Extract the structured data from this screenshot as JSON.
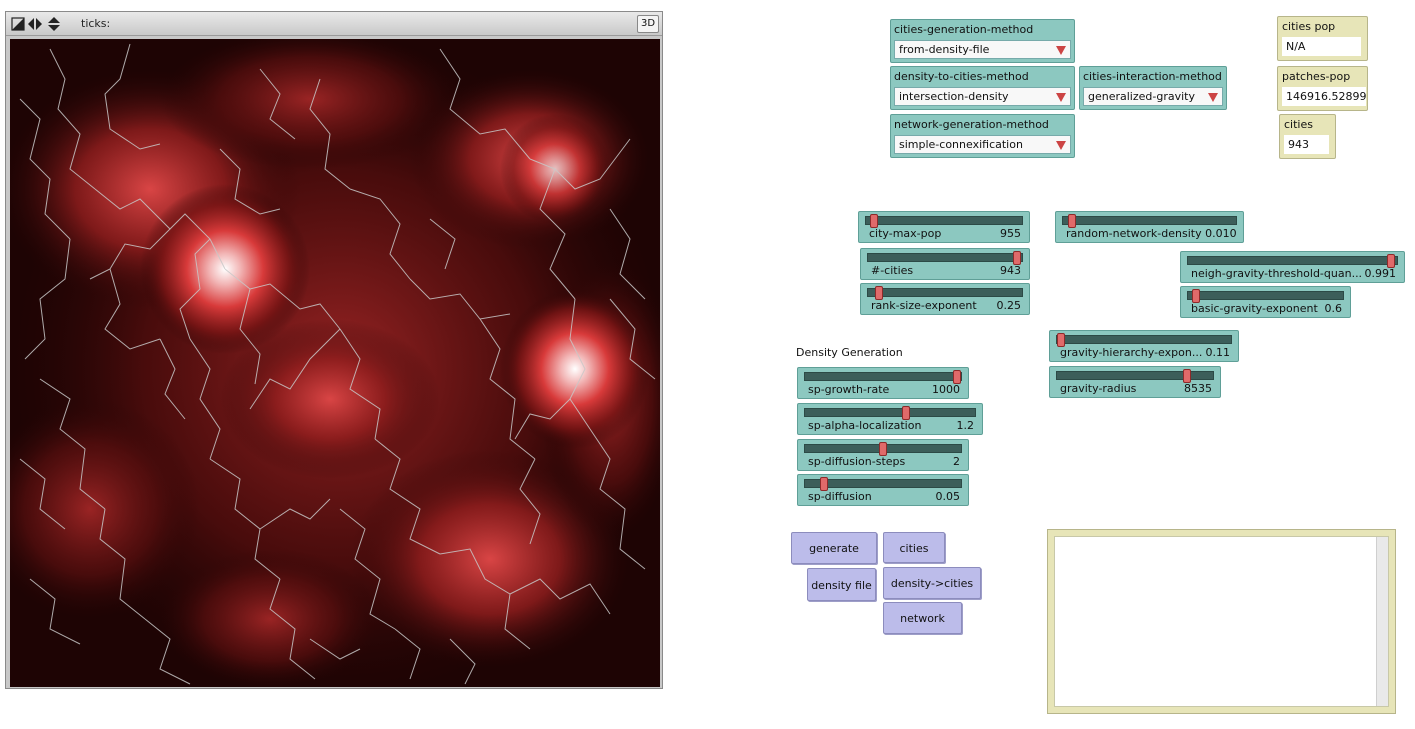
{
  "view": {
    "ticks_label": "ticks:",
    "btn_3d": "3D"
  },
  "choosers": {
    "cities_generation_method": {
      "label": "cities-generation-method",
      "value": "from-density-file"
    },
    "density_to_cities_method": {
      "label": "density-to-cities-method",
      "value": "intersection-density"
    },
    "cities_interaction_method": {
      "label": "cities-interaction-method",
      "value": "generalized-gravity"
    },
    "network_generation_method": {
      "label": "network-generation-method",
      "value": "simple-connexification"
    }
  },
  "monitors": {
    "cities_pop": {
      "label": "cities pop",
      "value": "N/A"
    },
    "patches_pop": {
      "label": "patches-pop",
      "value": "146916.52899"
    },
    "cities": {
      "label": "cities",
      "value": "943"
    }
  },
  "sliders": {
    "city_max_pop": {
      "name": "city-max-pop",
      "value": "955",
      "fraction": 0.03
    },
    "n_cities": {
      "name": "#-cities",
      "value": "943",
      "fraction": 0.99
    },
    "rank_size_exponent": {
      "name": "rank-size-exponent",
      "value": "0.25",
      "fraction": 0.05
    },
    "random_network_density": {
      "name": "random-network-density",
      "value": "0.010",
      "fraction": 0.03
    },
    "neigh_gravity_threshold": {
      "name": "neigh-gravity-threshold-quan...",
      "value": "0.991",
      "fraction": 0.99
    },
    "basic_gravity_exponent": {
      "name": "basic-gravity-exponent",
      "value": "0.6",
      "fraction": 0.03
    },
    "gravity_hierarchy_exponent": {
      "name": "gravity-hierarchy-expon...",
      "value": "0.11",
      "fraction": 0.0
    },
    "gravity_radius": {
      "name": "gravity-radius",
      "value": "8535",
      "fraction": 0.85
    },
    "sp_growth_rate": {
      "name": "sp-growth-rate",
      "value": "1000",
      "fraction": 1.0
    },
    "sp_alpha_localization": {
      "name": "sp-alpha-localization",
      "value": "1.2",
      "fraction": 0.6
    },
    "sp_diffusion_steps": {
      "name": "sp-diffusion-steps",
      "value": "2",
      "fraction": 0.5
    },
    "sp_diffusion": {
      "name": "sp-diffusion",
      "value": "0.05",
      "fraction": 0.1
    }
  },
  "notes": {
    "density_generation": "Density Generation"
  },
  "buttons": {
    "generate": "generate",
    "cities": "cities",
    "density_file": "density file",
    "density_to_cities": "density->cities",
    "network": "network"
  },
  "colors": {
    "chooser_bg": "#8cc8c0",
    "monitor_bg": "#e7e5b8",
    "button_bg": "#bcbcea",
    "slider_thumb": "#e06a6a"
  }
}
